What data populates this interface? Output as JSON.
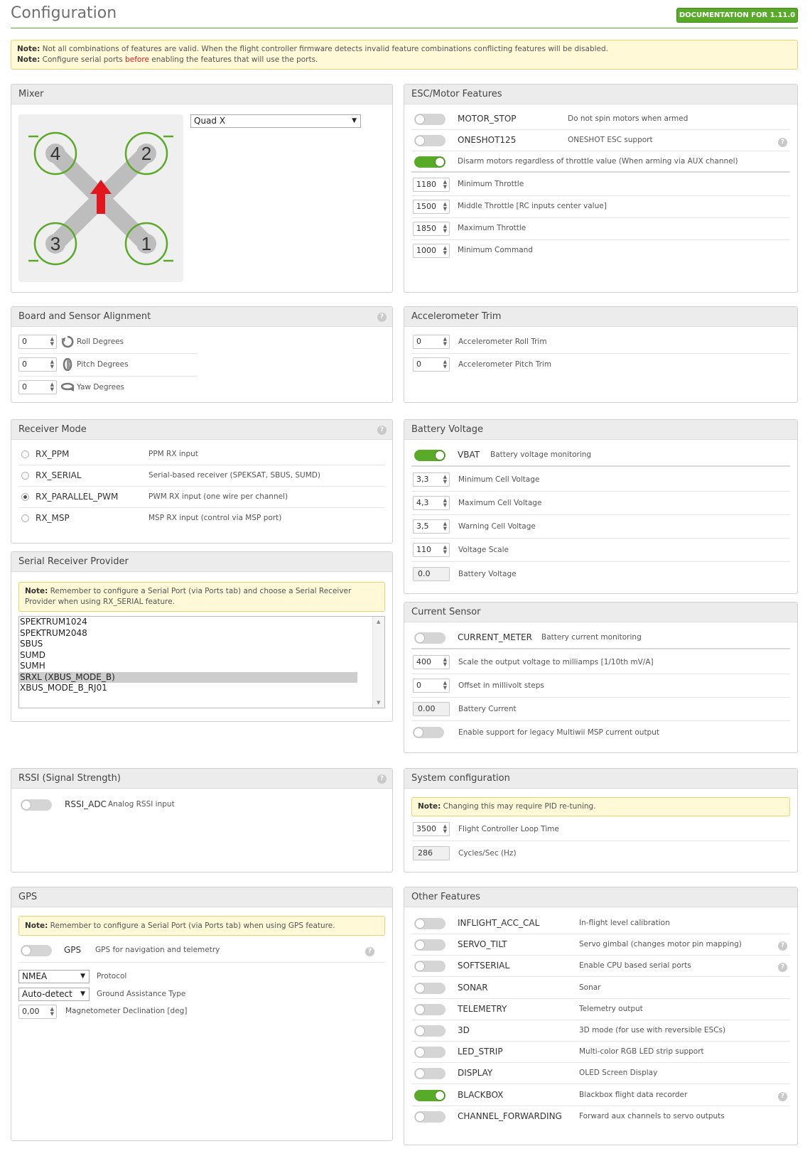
{
  "header": {
    "title": "Configuration",
    "doc_button": "DOCUMENTATION FOR 1.11.0"
  },
  "top_note": {
    "line1_bold": "Note:",
    "line1_text": " Not all combinations of features are valid. When the flight controller firmware detects invalid feature combinations conflicting features will be disabled.",
    "line2_bold": "Note:",
    "line2_pre": " Configure serial ports ",
    "line2_red": "before",
    "line2_post": " enabling the features that will use the ports."
  },
  "mixer": {
    "title": "Mixer",
    "selected": "Quad X",
    "motor_labels": [
      "4",
      "2",
      "3",
      "1"
    ]
  },
  "esc": {
    "title": "ESC/Motor Features",
    "features": [
      {
        "name": "MOTOR_STOP",
        "desc": "Do not spin motors when armed",
        "on": false
      },
      {
        "name": "ONESHOT125",
        "desc": "ONESHOT ESC support",
        "on": false
      }
    ],
    "disarm_text": "Disarm motors regardless of throttle value (When arming via AUX channel)",
    "disarm_on": true,
    "fields": [
      {
        "value": "1180",
        "label": "Minimum Throttle"
      },
      {
        "value": "1500",
        "label": "Middle Throttle [RC inputs center value]"
      },
      {
        "value": "1850",
        "label": "Maximum Throttle"
      },
      {
        "value": "1000",
        "label": "Minimum Command"
      }
    ]
  },
  "board": {
    "title": "Board and Sensor Alignment",
    "fields": [
      {
        "value": "0",
        "label": "Roll Degrees"
      },
      {
        "value": "0",
        "label": "Pitch Degrees"
      },
      {
        "value": "0",
        "label": "Yaw Degrees"
      }
    ]
  },
  "acc": {
    "title": "Accelerometer Trim",
    "fields": [
      {
        "value": "0",
        "label": "Accelerometer Roll Trim"
      },
      {
        "value": "0",
        "label": "Accelerometer Pitch Trim"
      }
    ]
  },
  "receiver": {
    "title": "Receiver Mode",
    "modes": [
      {
        "name": "RX_PPM",
        "desc": "PPM RX input",
        "checked": false
      },
      {
        "name": "RX_SERIAL",
        "desc": "Serial-based receiver (SPEKSAT, SBUS, SUMD)",
        "checked": false
      },
      {
        "name": "RX_PARALLEL_PWM",
        "desc": "PWM RX input (one wire per channel)",
        "checked": true
      },
      {
        "name": "RX_MSP",
        "desc": "MSP RX input (control via MSP port)",
        "checked": false
      }
    ]
  },
  "serial_rx": {
    "title": "Serial Receiver Provider",
    "note_bold": "Note:",
    "note_text": " Remember to configure a Serial Port (via Ports tab) and choose a Serial Receiver Provider when using RX_SERIAL feature.",
    "options": [
      "SPEKTRUM1024",
      "SPEKTRUM2048",
      "SBUS",
      "SUMD",
      "SUMH",
      "SRXL (XBUS_MODE_B)",
      "XBUS_MODE_B_RJ01"
    ],
    "selected_index": 5
  },
  "battery": {
    "title": "Battery Voltage",
    "vbat_name": "VBAT",
    "vbat_desc": "Battery voltage monitoring",
    "vbat_on": true,
    "fields": [
      {
        "value": "3,3",
        "label": "Minimum Cell Voltage"
      },
      {
        "value": "4,3",
        "label": "Maximum Cell Voltage"
      },
      {
        "value": "3,5",
        "label": "Warning Cell Voltage"
      },
      {
        "value": "110",
        "label": "Voltage Scale"
      }
    ],
    "readout_value": "0.0",
    "readout_label": "Battery Voltage"
  },
  "current": {
    "title": "Current Sensor",
    "meter_name": "CURRENT_METER",
    "meter_desc": "Battery current monitoring",
    "meter_on": false,
    "fields": [
      {
        "value": "400",
        "label": "Scale the output voltage to milliamps [1/10th mV/A]"
      },
      {
        "value": "0",
        "label": "Offset in millivolt steps"
      }
    ],
    "readout_value": "0.00",
    "readout_label": "Battery Current",
    "legacy_label": "Enable support for legacy Multiwii MSP current output",
    "legacy_on": false
  },
  "rssi": {
    "title": "RSSI (Signal Strength)",
    "name": "RSSI_ADC",
    "desc": "Analog RSSI input",
    "on": false
  },
  "system": {
    "title": "System configuration",
    "note_bold": "Note:",
    "note_text": " Changing this may require PID re-tuning.",
    "loop_value": "3500",
    "loop_label": "Flight Controller Loop Time",
    "cycles_value": "286",
    "cycles_label": "Cycles/Sec (Hz)"
  },
  "gps": {
    "title": "GPS",
    "note_bold": "Note:",
    "note_text": " Remember to configure a Serial Port (via Ports tab) when using GPS feature.",
    "name": "GPS",
    "desc": "GPS for navigation and telemetry",
    "on": false,
    "protocol_value": "NMEA",
    "protocol_label": "Protocol",
    "ground_value": "Auto-detect",
    "ground_label": "Ground Assistance Type",
    "mag_value": "0,00",
    "mag_label": "Magnetometer Declination [deg]"
  },
  "other": {
    "title": "Other Features",
    "features": [
      {
        "name": "INFLIGHT_ACC_CAL",
        "desc": "In-flight level calibration",
        "on": false
      },
      {
        "name": "SERVO_TILT",
        "desc": "Servo gimbal (changes motor pin mapping)",
        "on": false
      },
      {
        "name": "SOFTSERIAL",
        "desc": "Enable CPU based serial ports",
        "on": false
      },
      {
        "name": "SONAR",
        "desc": "Sonar",
        "on": false
      },
      {
        "name": "TELEMETRY",
        "desc": "Telemetry output",
        "on": false
      },
      {
        "name": "3D",
        "desc": "3D mode (for use with reversible ESCs)",
        "on": false
      },
      {
        "name": "LED_STRIP",
        "desc": "Multi-color RGB LED strip support",
        "on": false
      },
      {
        "name": "DISPLAY",
        "desc": "OLED Screen Display",
        "on": false
      },
      {
        "name": "BLACKBOX",
        "desc": "Blackbox flight data recorder",
        "on": true
      },
      {
        "name": "CHANNEL_FORWARDING",
        "desc": "Forward aux channels to servo outputs",
        "on": false
      }
    ]
  },
  "colors": {
    "accent_green": "#59aa29",
    "note_background": "#fff9d7",
    "mixer_arrow": "#e2161d"
  }
}
